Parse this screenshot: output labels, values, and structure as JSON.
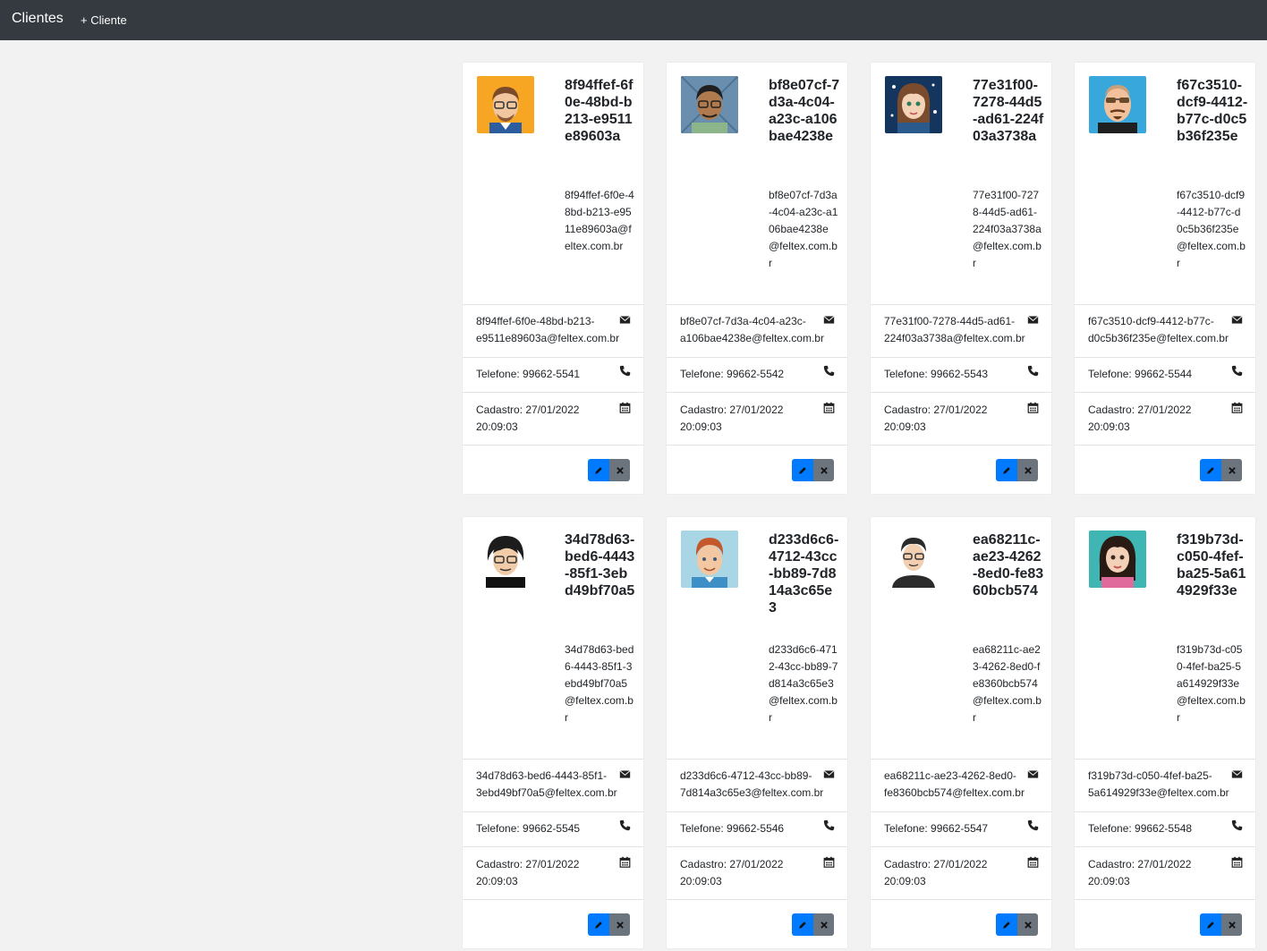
{
  "navbar": {
    "brand": "Clientes",
    "add_client": "+ Cliente"
  },
  "clients": [
    {
      "title": "8f94ffef-6f0e-48bd-b213-e9511e89603a",
      "email": "8f94ffef-6f0e-48bd-b213-e9511e89603a@feltex.com.br",
      "phone": "Telefone: 99662-5541",
      "registered": "Cadastro: 27/01/2022 20:09:03",
      "avatar": "avatar-man-glasses-orange"
    },
    {
      "title": "bf8e07cf-7d3a-4c04-a23c-a106bae4238e",
      "email": "bf8e07cf-7d3a-4c04-a23c-a106bae4238e@feltex.com.br",
      "phone": "Telefone: 99662-5542",
      "registered": "Cadastro: 27/01/2022 20:09:03",
      "avatar": "avatar-man-glasses-blue"
    },
    {
      "title": "77e31f00-7278-44d5-ad61-224f03a3738a",
      "email": "77e31f00-7278-44d5-ad61-224f03a3738a@feltex.com.br",
      "phone": "Telefone: 99662-5543",
      "registered": "Cadastro: 27/01/2022 20:09:03",
      "avatar": "avatar-woman-dark-blue"
    },
    {
      "title": "f67c3510-dcf9-4412-b77c-d0c5b36f235e",
      "email": "f67c3510-dcf9-4412-b77c-d0c5b36f235e@feltex.com.br",
      "phone": "Telefone: 99662-5544",
      "registered": "Cadastro: 27/01/2022 20:09:03",
      "avatar": "avatar-man-sunglasses"
    },
    {
      "title": "34d78d63-bed6-4443-85f1-3ebd49bf70a5",
      "email": "34d78d63-bed6-4443-85f1-3ebd49bf70a5@feltex.com.br",
      "phone": "Telefone: 99662-5545",
      "registered": "Cadastro: 27/01/2022 20:09:03",
      "avatar": "avatar-man-dark-hair"
    },
    {
      "title": "d233d6c6-4712-43cc-bb89-7d814a3c65e3",
      "email": "d233d6c6-4712-43cc-bb89-7d814a3c65e3@feltex.com.br",
      "phone": "Telefone: 99662-5546",
      "registered": "Cadastro: 27/01/2022 20:09:03",
      "avatar": "avatar-man-red-hair"
    },
    {
      "title": "ea68211c-ae23-4262-8ed0-fe8360bcb574",
      "email": "ea68211c-ae23-4262-8ed0-fe8360bcb574@feltex.com.br",
      "phone": "Telefone: 99662-5547",
      "registered": "Cadastro: 27/01/2022 20:09:03",
      "avatar": "avatar-man-black-shirt"
    },
    {
      "title": "f319b73d-c050-4fef-ba25-5a614929f33e",
      "email": "f319b73d-c050-4fef-ba25-5a614929f33e@feltex.com.br",
      "phone": "Telefone: 99662-5548",
      "registered": "Cadastro: 27/01/2022 20:09:03",
      "avatar": "avatar-woman-pink"
    }
  ],
  "colors": {
    "navbar": "#343a40",
    "edit_button": "#007bff",
    "delete_button": "#6c757d"
  },
  "icons": {
    "email": "envelope-icon",
    "phone": "phone-icon",
    "date": "calendar-icon",
    "edit": "pencil-icon",
    "delete": "close-icon"
  }
}
